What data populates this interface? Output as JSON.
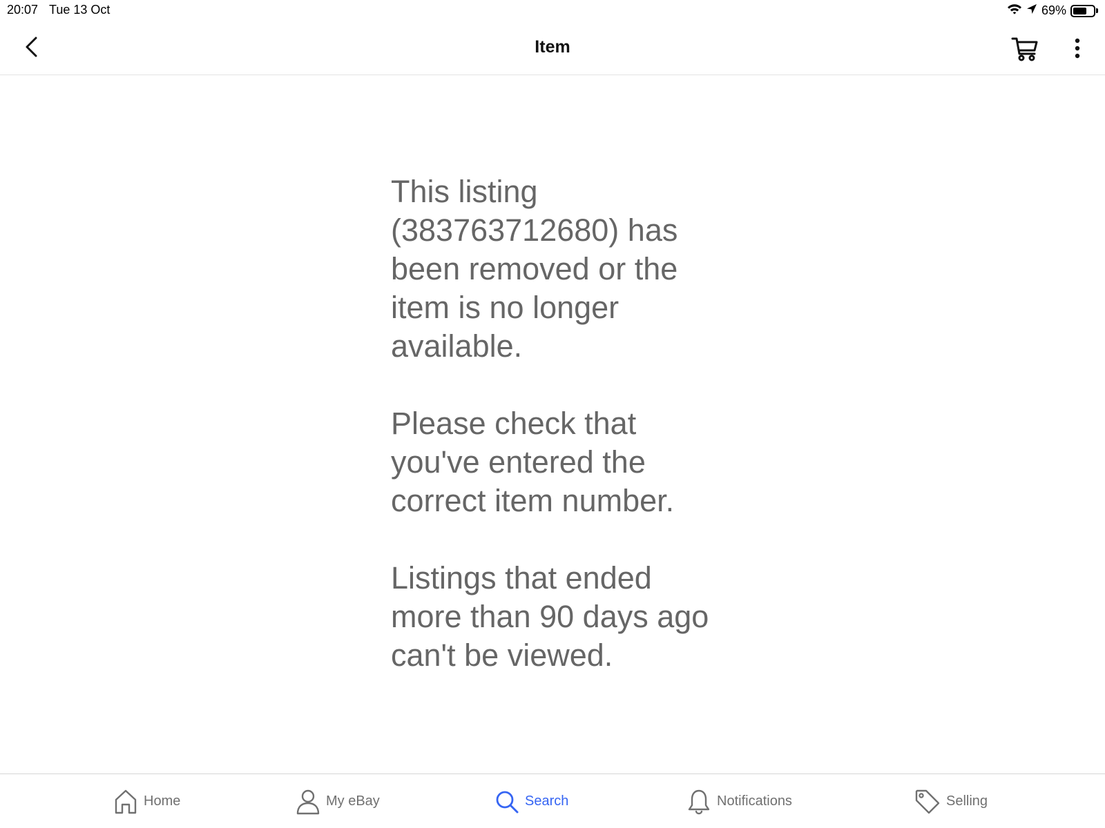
{
  "status_bar": {
    "time": "20:07",
    "date": "Tue 13 Oct",
    "battery_percent": "69%",
    "battery_level": 0.69,
    "icons": [
      "wifi-icon",
      "location-arrow-icon",
      "battery-icon"
    ]
  },
  "top_nav": {
    "title": "Item",
    "back_icon": "chevron-left-icon",
    "cart_icon": "cart-icon",
    "more_icon": "more-vertical-icon"
  },
  "message": {
    "paragraph_1": "This listing (383763712680) has been removed or the item is no longer available.",
    "paragraph_2": "Please check that you've entered the correct item number.",
    "paragraph_3": "Listings that ended more than 90 days ago can't be viewed."
  },
  "tab_bar": {
    "active_color": "#3665f3",
    "inactive_color": "#707070",
    "tabs": [
      {
        "label": "Home",
        "icon": "home-icon",
        "active": false
      },
      {
        "label": "My eBay",
        "icon": "user-icon",
        "active": false
      },
      {
        "label": "Search",
        "icon": "search-icon",
        "active": true
      },
      {
        "label": "Notifications",
        "icon": "bell-icon",
        "active": false
      },
      {
        "label": "Selling",
        "icon": "tag-icon",
        "active": false
      }
    ]
  }
}
